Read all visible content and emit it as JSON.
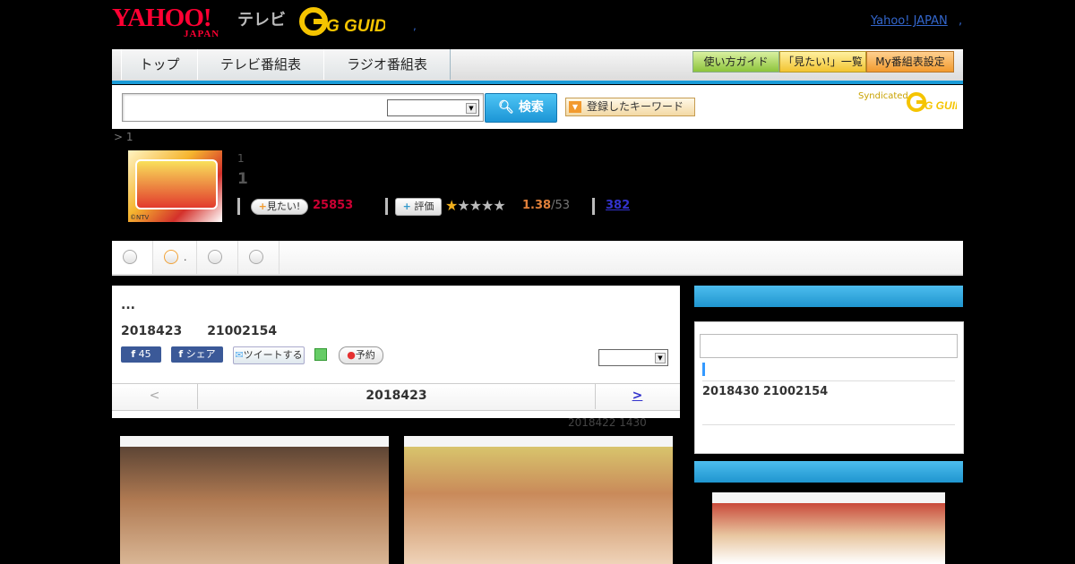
{
  "header": {
    "yahoo_logo": "YAHOO!",
    "yahoo_sub": "JAPAN",
    "tv_label": "テレビ",
    "gguide_logo": "G GUIDE",
    "dot": ",",
    "yj_link": "Yahoo! JAPAN",
    "yj_dot": ","
  },
  "nav": {
    "tabs": [
      "トップ",
      "テレビ番組表",
      "ラジオ番組表"
    ],
    "guide_buttons": [
      "使い方ガイド",
      "「見たい!」一覧",
      "My番組表設定"
    ]
  },
  "search": {
    "button_label": "検索",
    "keyword_button": "登録したキーワード",
    "syndicated": "Syndicated",
    "syndicated_logo": "G GUIDE"
  },
  "program": {
    "breadcrumb": "> 1",
    "thumb_credit": "©NTV",
    "line1": "1",
    "line2": "1",
    "mitai_label": "見たい!",
    "mitai_count": "25853",
    "hyoka_label": "評価",
    "rating": "1.38",
    "rating_total": "/53",
    "review_count": "382"
  },
  "tabs": {
    "dot": "."
  },
  "episode": {
    "title": "...",
    "date_line": "2018423　　21002154",
    "fb_like_count": "45",
    "fb_share": "シェア",
    "tweet": "ツイートする",
    "reserve": "予約",
    "prev": "<",
    "current": "2018423",
    "next": ">",
    "updated": "2018422  1430"
  },
  "right": {
    "next_broadcast": "2018430  21002154"
  },
  "colors": {
    "accent_blue": "#1a9bd7",
    "mitai_red": "#cc0033",
    "rating_orange": "#e0803a"
  }
}
